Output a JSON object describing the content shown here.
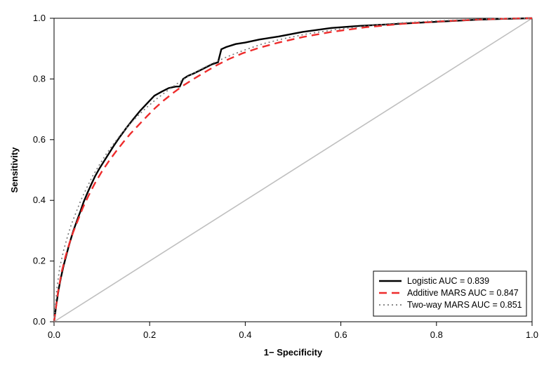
{
  "chart_data": {
    "type": "line",
    "title": "",
    "xlabel": "1− Specificity",
    "ylabel": "Sensitivity",
    "xlim": [
      0.0,
      1.0
    ],
    "ylim": [
      0.0,
      1.0
    ],
    "xticks": [
      0.0,
      0.2,
      0.4,
      0.6,
      0.8,
      1.0
    ],
    "yticks": [
      0.0,
      0.2,
      0.4,
      0.6,
      0.8,
      1.0
    ],
    "legend_position": "bottomright",
    "reference_line": {
      "from": [
        0,
        0
      ],
      "to": [
        1,
        1
      ],
      "color": "#bfbfbf"
    },
    "series": [
      {
        "name": "Logistic AUC = 0.839",
        "auc": 0.839,
        "style": "solid",
        "color": "#000000",
        "x": [
          0.0,
          0.005,
          0.01,
          0.015,
          0.02,
          0.025,
          0.03,
          0.035,
          0.04,
          0.045,
          0.05,
          0.055,
          0.062,
          0.07,
          0.078,
          0.086,
          0.095,
          0.105,
          0.115,
          0.125,
          0.138,
          0.152,
          0.166,
          0.18,
          0.195,
          0.21,
          0.225,
          0.24,
          0.255,
          0.263,
          0.27,
          0.28,
          0.292,
          0.31,
          0.33,
          0.343,
          0.35,
          0.36,
          0.38,
          0.4,
          0.43,
          0.47,
          0.52,
          0.58,
          0.64,
          0.7,
          0.76,
          0.82,
          0.88,
          0.94,
          0.97,
          0.99,
          1.0
        ],
        "y": [
          0.0,
          0.06,
          0.11,
          0.15,
          0.185,
          0.215,
          0.245,
          0.272,
          0.298,
          0.32,
          0.342,
          0.363,
          0.395,
          0.425,
          0.453,
          0.48,
          0.505,
          0.53,
          0.555,
          0.58,
          0.61,
          0.64,
          0.668,
          0.695,
          0.72,
          0.745,
          0.758,
          0.77,
          0.775,
          0.775,
          0.8,
          0.81,
          0.818,
          0.832,
          0.848,
          0.855,
          0.898,
          0.905,
          0.915,
          0.92,
          0.93,
          0.94,
          0.955,
          0.968,
          0.975,
          0.98,
          0.985,
          0.99,
          0.995,
          0.998,
          0.999,
          1.0,
          1.0
        ]
      },
      {
        "name": "Additive MARS AUC = 0.847",
        "auc": 0.847,
        "style": "dashed",
        "color": "#ee2c2c",
        "x": [
          0.0,
          0.008,
          0.016,
          0.024,
          0.032,
          0.04,
          0.05,
          0.06,
          0.072,
          0.085,
          0.1,
          0.115,
          0.13,
          0.145,
          0.16,
          0.178,
          0.195,
          0.212,
          0.23,
          0.25,
          0.27,
          0.292,
          0.315,
          0.34,
          0.365,
          0.395,
          0.43,
          0.47,
          0.52,
          0.58,
          0.65,
          0.73,
          0.81,
          0.89,
          0.95,
          0.985,
          1.0
        ],
        "y": [
          0.0,
          0.095,
          0.165,
          0.215,
          0.258,
          0.295,
          0.335,
          0.375,
          0.415,
          0.455,
          0.495,
          0.53,
          0.562,
          0.592,
          0.62,
          0.65,
          0.678,
          0.705,
          0.73,
          0.755,
          0.778,
          0.8,
          0.822,
          0.845,
          0.865,
          0.885,
          0.903,
          0.92,
          0.938,
          0.955,
          0.97,
          0.982,
          0.99,
          0.996,
          0.999,
          1.0,
          1.0
        ]
      },
      {
        "name": "Two-way MARS AUC = 0.851",
        "auc": 0.851,
        "style": "dotted",
        "color": "#7a7a7a",
        "x": [
          0.0,
          0.006,
          0.012,
          0.02,
          0.028,
          0.036,
          0.046,
          0.056,
          0.068,
          0.08,
          0.094,
          0.108,
          0.124,
          0.14,
          0.158,
          0.176,
          0.195,
          0.215,
          0.236,
          0.258,
          0.282,
          0.308,
          0.336,
          0.365,
          0.398,
          0.435,
          0.478,
          0.528,
          0.585,
          0.65,
          0.72,
          0.795,
          0.87,
          0.935,
          0.98,
          1.0
        ],
        "y": [
          0.0,
          0.11,
          0.18,
          0.235,
          0.28,
          0.32,
          0.36,
          0.4,
          0.44,
          0.478,
          0.515,
          0.55,
          0.585,
          0.618,
          0.65,
          0.68,
          0.708,
          0.735,
          0.76,
          0.785,
          0.81,
          0.833,
          0.855,
          0.875,
          0.895,
          0.915,
          0.932,
          0.948,
          0.962,
          0.974,
          0.984,
          0.991,
          0.996,
          0.999,
          1.0,
          1.0
        ]
      }
    ]
  }
}
